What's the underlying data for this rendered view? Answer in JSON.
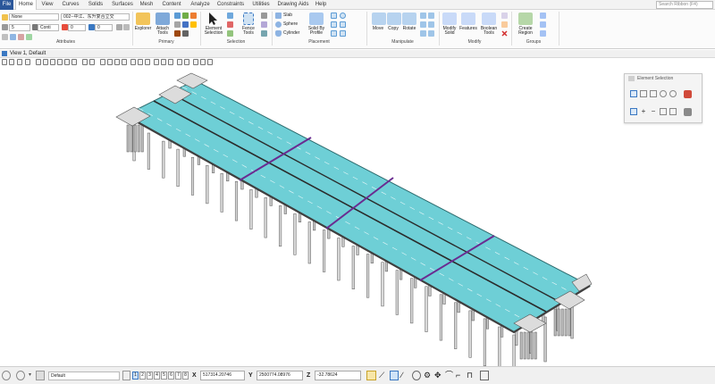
{
  "tabs": [
    {
      "label": "File"
    },
    {
      "label": "Home"
    },
    {
      "label": "View"
    },
    {
      "label": "Curves"
    },
    {
      "label": "Solids"
    },
    {
      "label": "Surfaces"
    },
    {
      "label": "Mesh"
    },
    {
      "label": "Content"
    },
    {
      "label": "Analyze"
    },
    {
      "label": "Constraints"
    },
    {
      "label": "Utilities"
    },
    {
      "label": "Drawing Aids"
    },
    {
      "label": "Help"
    }
  ],
  "search_placeholder": "Search Ribbon (F4)",
  "attributes": {
    "level_value": "None",
    "model_value": "002--中江、东升复合立交",
    "weight_value": "5",
    "style_value": "Conti",
    "color_value": "0",
    "transparency_value": "0"
  },
  "groups": {
    "attributes": "Attributes",
    "primary": "Primary",
    "selection": "Selection",
    "placement": "Placement",
    "manipulate": "Manipulate",
    "modify": "Modify",
    "groups": "Groups"
  },
  "buttons": {
    "explorer": "Explorer",
    "attach_tools": "Attach Tools",
    "element_selection": "Element Selection",
    "fence_tools": "Fence Tools",
    "slab": "Slab",
    "sphere": "Sphere",
    "cylinder": "Cylinder",
    "solid_by_profile": "Solid By Profile",
    "move": "Move",
    "copy": "Copy",
    "rotate": "Rotate",
    "modify_solid": "Modify Solid",
    "features": "Features",
    "boolean_tools": "Boolean Tools",
    "create_region": "Create Region"
  },
  "view": {
    "title": "View 1, Default"
  },
  "element_selection_dialog": {
    "title": "Element Selection"
  },
  "status": {
    "view_group": "Default",
    "view_numbers": [
      "1",
      "2",
      "3",
      "4",
      "5",
      "6",
      "7",
      "8"
    ],
    "x_label": "X",
    "x_value": "517314.20746",
    "y_label": "Y",
    "y_value": "2500774.08976",
    "z_label": "Z",
    "z_value": "-32.78624"
  },
  "colors": {
    "deck": "#6ecfd6",
    "deck_edge": "#2d6b6e",
    "divider": "#6a2c91",
    "file_tab": "#2b579a"
  }
}
